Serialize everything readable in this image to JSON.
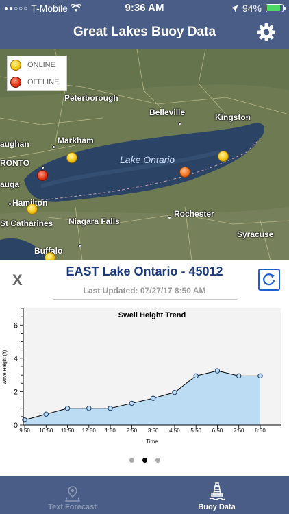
{
  "status_bar": {
    "carrier": "T-Mobile",
    "time": "9:36 AM",
    "battery": "94%"
  },
  "nav": {
    "title": "Great Lakes Buoy Data"
  },
  "map": {
    "legend": {
      "online": "ONLINE",
      "offline": "OFFLINE"
    },
    "lake_label": "Lake Ontario",
    "places": {
      "peterborough": "Peterborough",
      "belleville": "Belleville",
      "kingston": "Kingston",
      "markham": "Markham",
      "vaughan": "aughan",
      "toronto": "RONTO",
      "mississauga": "auga",
      "hamilton": "Hamilton",
      "st_catharines": "St Catharines",
      "niagara_falls": "Niagara Falls",
      "rochester": "Rochester",
      "syracuse": "Syracuse",
      "buffalo": "Buffalo"
    }
  },
  "detail": {
    "close": "X",
    "station": "EAST Lake Ontario - 45012",
    "updated": "Last Updated: 07/27/17 8:50 AM"
  },
  "chart_data": {
    "type": "area",
    "title": "Swell Height Trend",
    "xlabel": "Time",
    "ylabel": "Wave Height (ft)",
    "categories": [
      "9:50",
      "10:50",
      "11:50",
      "12:50",
      "1:50",
      "2:50",
      "3:50",
      "4:50",
      "5:50",
      "6:50",
      "7:50",
      "8:50"
    ],
    "values": [
      0.3,
      0.65,
      1.0,
      1.0,
      1.0,
      1.3,
      1.6,
      1.95,
      2.95,
      3.25,
      2.95,
      2.95
    ],
    "ylim": [
      0,
      7
    ],
    "yticks": [
      0,
      2,
      4,
      6
    ],
    "fill_color": "#bcdcf4",
    "line_color": "#000000"
  },
  "pager": {
    "count": 3,
    "active": 1
  },
  "tabs": [
    {
      "label": "Text Forecast",
      "icon": "map-pin-icon"
    },
    {
      "label": "Buoy Data",
      "icon": "buoy-icon"
    }
  ]
}
